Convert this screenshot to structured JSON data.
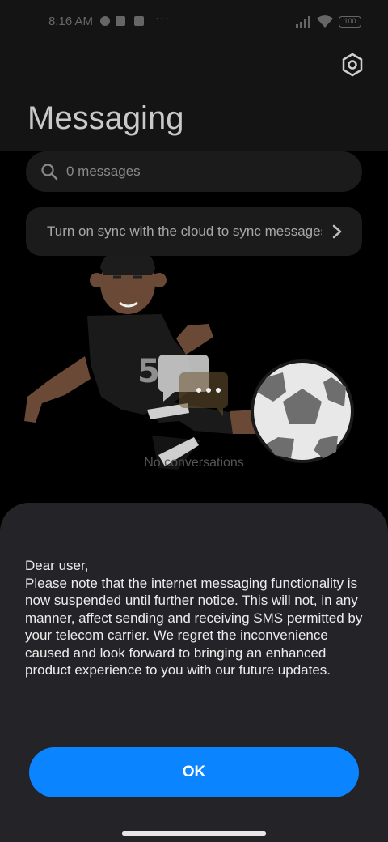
{
  "status_bar": {
    "time": "8:16 AM",
    "more": "···",
    "battery": "100"
  },
  "header": {
    "title": "Messaging",
    "settings_icon": "settings-hex-icon"
  },
  "search": {
    "icon": "search-icon",
    "text": "0 messages"
  },
  "sync_banner": {
    "text": "Turn on sync with the cloud to sync messages",
    "icon": "chevron-right-icon"
  },
  "empty_state": {
    "label": "No conversations",
    "illustration": "footballer-kicking-ball-illustration"
  },
  "dialog": {
    "greeting": "Dear user,",
    "body": "Please note that the internet messaging functionality is now suspended until further notice. This will not, in any manner, affect sending and receiving SMS permitted by your telecom carrier. We regret the inconvenience caused and look forward to bringing an enhanced product experience to you with our future updates.",
    "ok_label": "OK"
  },
  "colors": {
    "accent": "#0a84ff",
    "sheet": "#242428",
    "header": "#141414"
  }
}
